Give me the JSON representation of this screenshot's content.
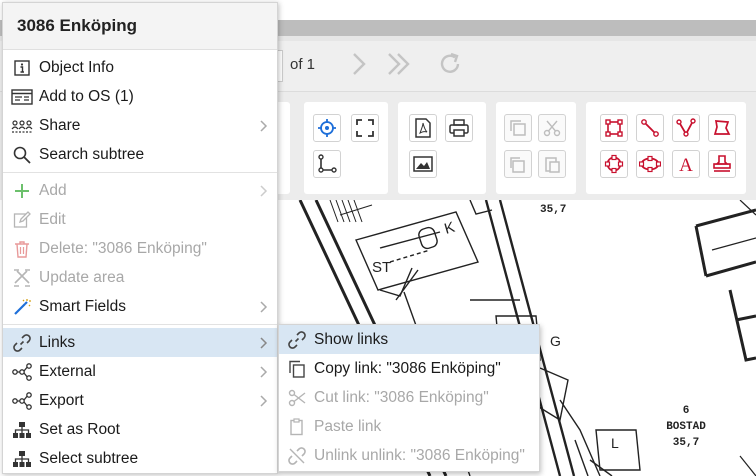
{
  "pager": {
    "of_label": "of 1"
  },
  "menu": {
    "title": "3086 Enköping",
    "items": [
      {
        "label": "Object Info",
        "icon": "info-icon",
        "enabled": true,
        "submenu": false
      },
      {
        "label": "Add to OS (1)",
        "icon": "id-card-icon",
        "enabled": true,
        "submenu": false
      },
      {
        "label": "Share",
        "icon": "share-users-icon",
        "enabled": true,
        "submenu": true
      },
      {
        "label": "Search subtree",
        "icon": "search-icon",
        "enabled": true,
        "submenu": false
      },
      {
        "label": "Add",
        "icon": "plus-icon",
        "enabled": false,
        "submenu": true
      },
      {
        "label": "Edit",
        "icon": "edit-icon",
        "enabled": false,
        "submenu": false
      },
      {
        "label": "Delete: \"3086 Enköping\"",
        "icon": "trash-icon",
        "enabled": false,
        "submenu": false
      },
      {
        "label": "Update area",
        "icon": "update-area-icon",
        "enabled": false,
        "submenu": false
      },
      {
        "label": "Smart Fields",
        "icon": "magic-wand-icon",
        "enabled": true,
        "submenu": true
      },
      {
        "label": "Links",
        "icon": "link-icon",
        "enabled": true,
        "submenu": true,
        "active": true
      },
      {
        "label": "External",
        "icon": "network-icon",
        "enabled": true,
        "submenu": true
      },
      {
        "label": "Export",
        "icon": "network-icon",
        "enabled": true,
        "submenu": true
      },
      {
        "label": "Set as Root",
        "icon": "hierarchy-icon",
        "enabled": true,
        "submenu": false
      },
      {
        "label": "Select subtree",
        "icon": "hierarchy-icon",
        "enabled": true,
        "submenu": false
      }
    ]
  },
  "submenu": {
    "items": [
      {
        "label": "Show links",
        "icon": "link-icon",
        "enabled": true,
        "active": true
      },
      {
        "label": "Copy link: \"3086 Enköping\"",
        "icon": "copy-icon",
        "enabled": true
      },
      {
        "label": "Cut link: \"3086 Enköping\"",
        "icon": "scissors-icon",
        "enabled": false
      },
      {
        "label": "Paste link",
        "icon": "paste-icon",
        "enabled": false
      },
      {
        "label": "Unlink unlink: \"3086 Enköping\"",
        "icon": "unlink-icon",
        "enabled": false
      }
    ]
  },
  "drawing": {
    "labels": {
      "room_k": "K",
      "room_st": "ST",
      "room_g1": "G",
      "room_g2": "G",
      "room_l": "L",
      "dim_top": "35,7",
      "room_no": "6",
      "room_name": "BOSTAD",
      "room_area": "35,7"
    }
  },
  "colors": {
    "accent_red": "#c8102e",
    "accent_blue": "#1e6fd9",
    "active_bg": "#d8e6f3"
  }
}
